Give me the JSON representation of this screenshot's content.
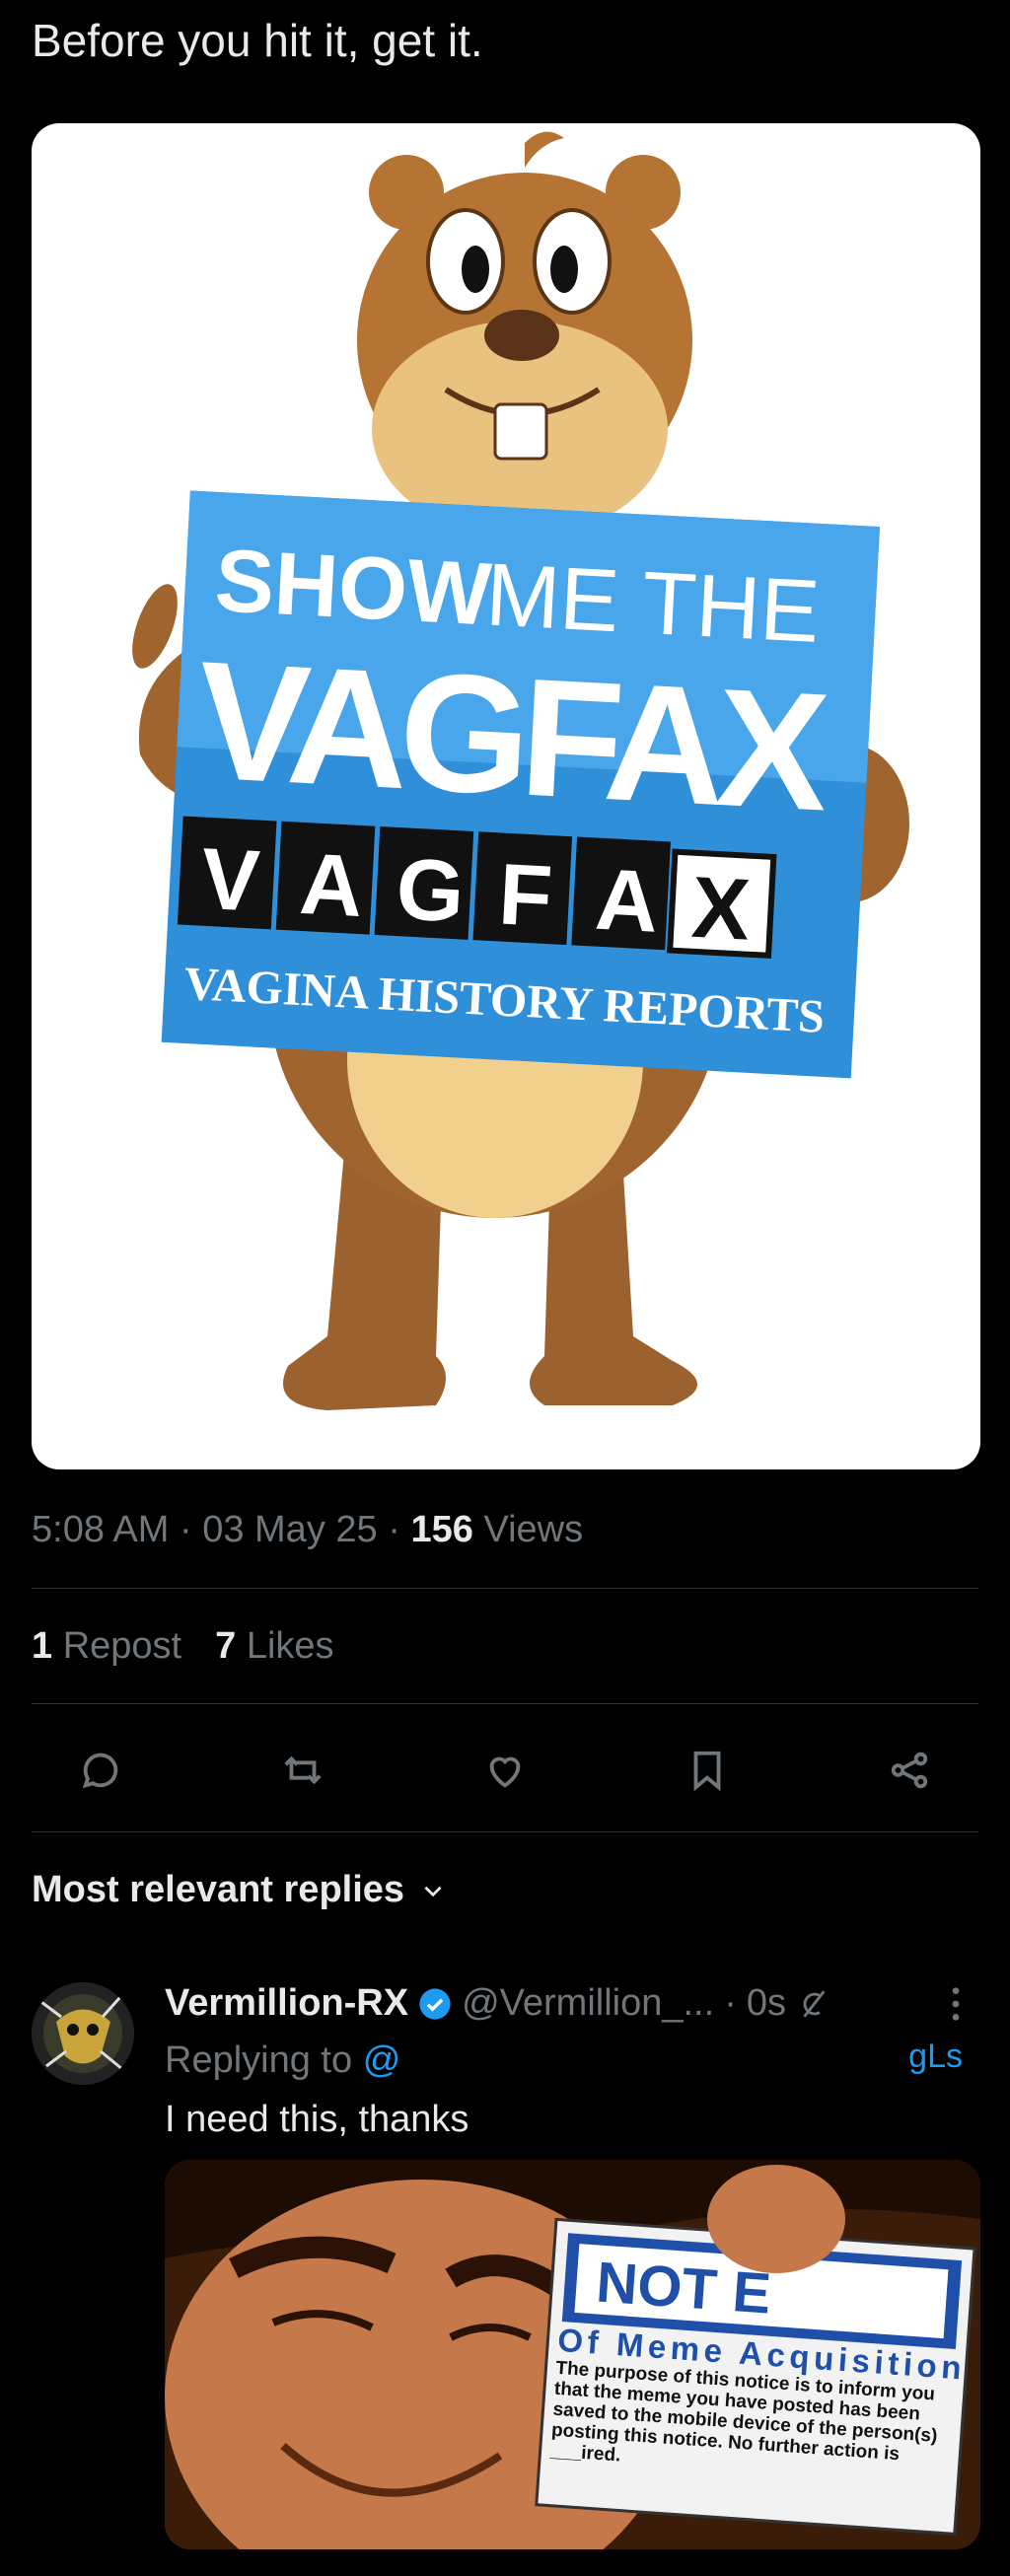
{
  "post": {
    "text": "Before you hit it, get it.",
    "image": {
      "line1a": "SHOW",
      "line1b": "ME THE",
      "big": "VAGFAX",
      "tiles": [
        "V",
        "A",
        "G",
        "F",
        "A",
        "X"
      ],
      "strip": "VAGINA HISTORY REPORTS"
    },
    "time": "5:08 AM",
    "date": "03 May 25",
    "views_count": "156",
    "views_label": "Views",
    "sep": "·"
  },
  "stats": {
    "reposts_count": "1",
    "reposts_label": "Repost",
    "likes_count": "7",
    "likes_label": "Likes"
  },
  "actions": [
    "reply-icon",
    "repost-icon",
    "like-icon",
    "bookmark-icon",
    "share-icon"
  ],
  "replies": {
    "header": "Most relevant replies",
    "items": [
      {
        "name": "Vermillion-RX",
        "handle": "@Vermillion_...",
        "sep": "·",
        "time": "0s",
        "replying_label": "Replying to",
        "replying_to": "@",
        "right_fragment": "gLs",
        "text": "I need this, thanks",
        "image": {
          "sign_title": "NOT  E",
          "sign_subtitle": "Of Meme Acquisition",
          "sign_body": "The purpose of this notice is to inform you that the meme you have posted has been saved to the mobile device of the person(s) posting this notice. No further action is ___ired."
        }
      }
    ]
  },
  "colors": {
    "accent": "#1d9bf0",
    "muted": "#71767b",
    "text": "#e7e9ea",
    "divider": "#2f3336"
  }
}
